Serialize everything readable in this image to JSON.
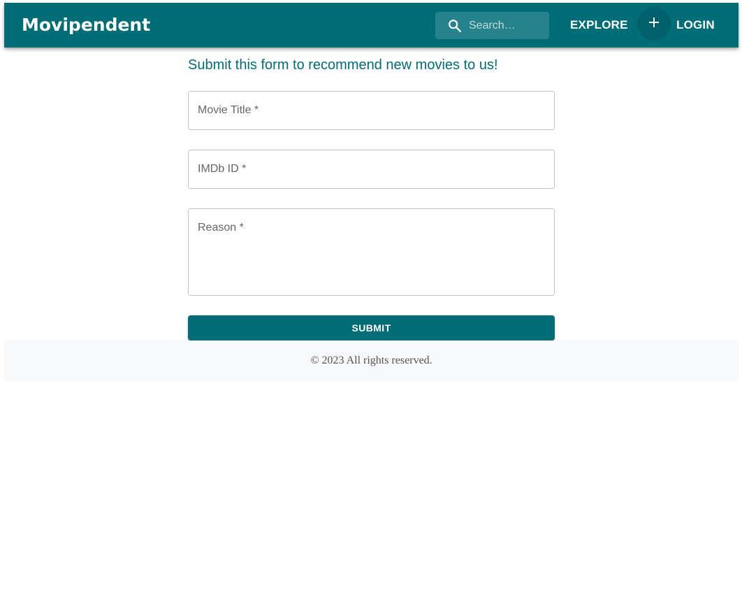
{
  "appbar": {
    "brand": "Movipendent",
    "search_placeholder": "Search…",
    "explore_label": "EXPLORE",
    "add_label": "+",
    "login_label": "LOGIN"
  },
  "form": {
    "heading": "Submit this form to recommend new movies to us!",
    "movie_title_label": "Movie Title *",
    "imdb_id_label": "IMDb ID *",
    "reason_label": "Reason *",
    "submit_label": "SUBMIT"
  },
  "footer": {
    "copyright": "© 2023 All rights reserved."
  },
  "colors": {
    "primary": "#016d77",
    "footer_bg": "#f7f8fa",
    "heading": "#016d77"
  },
  "icons": [
    "search-icon",
    "plus-icon"
  ]
}
